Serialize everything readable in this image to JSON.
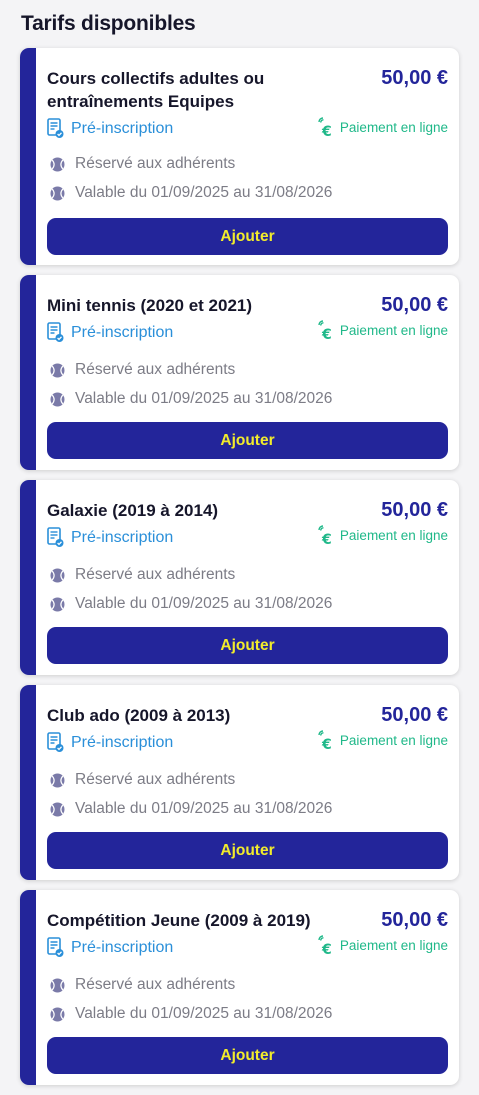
{
  "page": {
    "title": "Tarifs disponibles"
  },
  "colors": {
    "brand_navy": "#23259a",
    "button_text_yellow": "#f2ec2c",
    "pre_inscription_blue": "#2a8fd9",
    "online_payment_green": "#1fb889",
    "muted_text": "#7c7c86"
  },
  "icons": {
    "pre_inscription": "document-check-icon",
    "online_payment": "contactless-euro-icon",
    "info": "tennis-ball-icon"
  },
  "tarifs": [
    {
      "title": "Cours collectifs adultes ou entraînements Equipes",
      "price": "50,00 €",
      "pre_inscription": "Pré-inscription",
      "payment": "Paiement en ligne",
      "reserved": "Réservé aux adhérents",
      "validity": "Valable du 01/09/2025 au 31/08/2026",
      "button": "Ajouter"
    },
    {
      "title": "Mini tennis (2020 et 2021)",
      "price": "50,00 €",
      "pre_inscription": "Pré-inscription",
      "payment": "Paiement en ligne",
      "reserved": "Réservé aux adhérents",
      "validity": "Valable du 01/09/2025 au 31/08/2026",
      "button": "Ajouter"
    },
    {
      "title": "Galaxie (2019 à 2014)",
      "price": "50,00 €",
      "pre_inscription": "Pré-inscription",
      "payment": "Paiement en ligne",
      "reserved": "Réservé aux adhérents",
      "validity": "Valable du 01/09/2025 au 31/08/2026",
      "button": "Ajouter"
    },
    {
      "title": "Club ado (2009 à 2013)",
      "price": "50,00 €",
      "pre_inscription": "Pré-inscription",
      "payment": "Paiement en ligne",
      "reserved": "Réservé aux adhérents",
      "validity": "Valable du 01/09/2025 au 31/08/2026",
      "button": "Ajouter"
    },
    {
      "title": "Compétition Jeune (2009 à 2019)",
      "price": "50,00 €",
      "pre_inscription": "Pré-inscription",
      "payment": "Paiement en ligne",
      "reserved": "Réservé aux adhérents",
      "validity": "Valable du 01/09/2025 au 31/08/2026",
      "button": "Ajouter"
    }
  ]
}
